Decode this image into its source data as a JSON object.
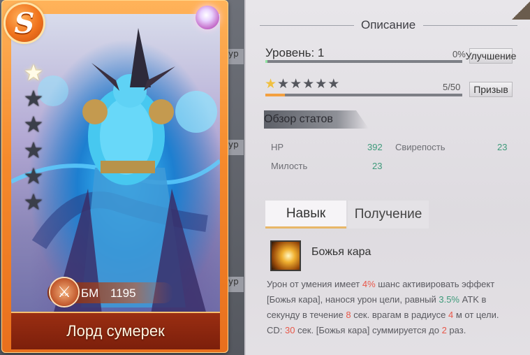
{
  "hero_card": {
    "rank_letter": "S",
    "stars_total": 6,
    "stars_active": 1,
    "bm_label": "БМ",
    "bm_value": "1195",
    "name": "Лорд сумерек"
  },
  "side_tabs": [
    "ур",
    "ур",
    "ур"
  ],
  "details": {
    "title": "Описание",
    "level_label": "Уровень: 1",
    "level_progress_text": "0%",
    "level_progress": 0.01,
    "upgrade_button": "Улучшение",
    "stars_filled": 1,
    "stars_total": 6,
    "star_progress_text": "5/50",
    "star_progress": 0.1,
    "summon_button": "Призыв",
    "stats_header": "Обзор статов",
    "stats": [
      {
        "label": "HP",
        "value": "392"
      },
      {
        "label": "Свирепость",
        "value": "23"
      },
      {
        "label": "Милость",
        "value": "23"
      }
    ],
    "tabs": {
      "skill": "Навык",
      "obtain": "Получение"
    },
    "skill": {
      "name": "Божья кара",
      "desc_parts": {
        "p1": "Урон от умения имеет ",
        "v1": "4%",
        "p2": " шанс активировать эффект [Божья кара], нанося урон цели, равный ",
        "v2": "3.5%",
        "p3": " ATK в секунду в течение ",
        "v3": "8",
        "p4": " сек. врагам в радиусе ",
        "v4": "4",
        "p5": " м от цели. CD: ",
        "v5": "30",
        "p6": " сек. [Божья кара] суммируется до ",
        "v6": "2",
        "p7": " раз."
      }
    }
  },
  "colors": {
    "card_orange": "#f58a2c",
    "stat_value_green": "#3e9a7a",
    "highlight_red": "#e8584a",
    "level_bar_green": "#8fe3a0",
    "star_bar_orange": "#f3a040"
  }
}
